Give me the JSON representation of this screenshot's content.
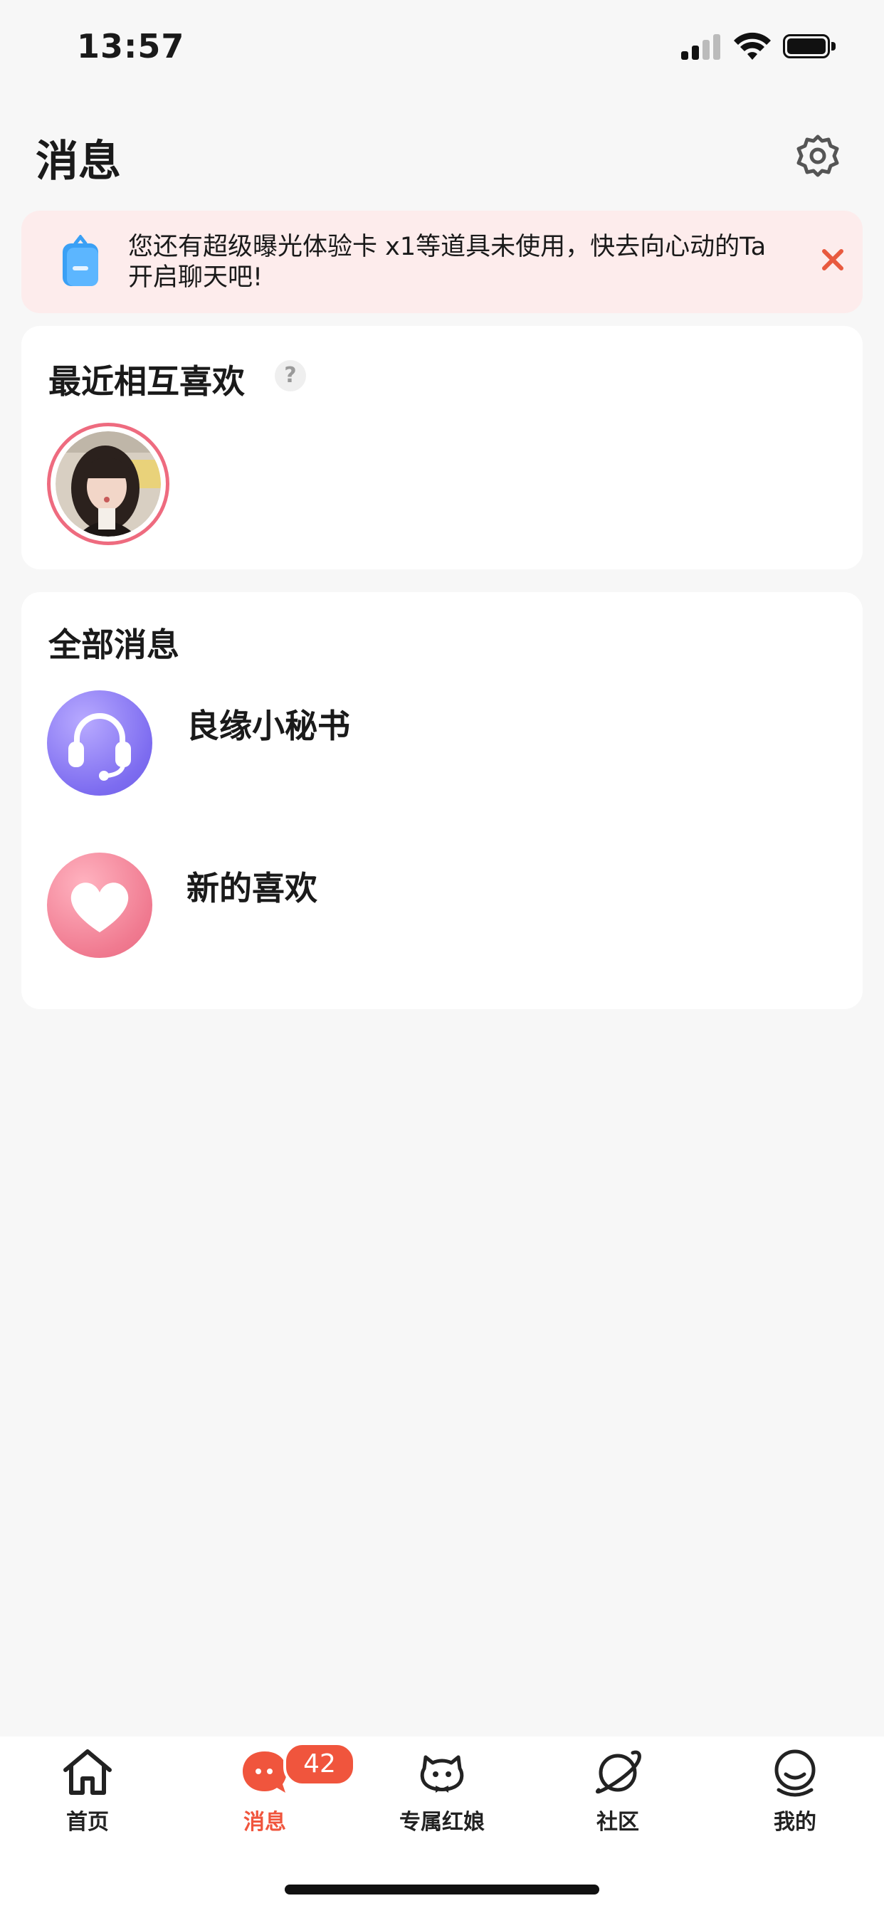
{
  "status_bar": {
    "time": "13:57"
  },
  "header": {
    "title": "消息"
  },
  "notice": {
    "text": "您还有超级曝光体验卡 x1等道具未使用，快去向心动的Ta开启聊天吧!"
  },
  "mutual_likes": {
    "title": "最近相互喜欢",
    "help": "?"
  },
  "all_messages": {
    "title": "全部消息",
    "items": [
      {
        "label": "良缘小秘书",
        "icon": "headset-icon"
      },
      {
        "label": "新的喜欢",
        "icon": "heart-icon"
      }
    ]
  },
  "tabbar": {
    "items": [
      {
        "label": "首页",
        "icon": "home-icon"
      },
      {
        "label": "消息",
        "icon": "chat-bubble-icon"
      },
      {
        "label": "专属红娘",
        "icon": "matchmaker-icon"
      },
      {
        "label": "社区",
        "icon": "planet-icon"
      },
      {
        "label": "我的",
        "icon": "profile-icon"
      }
    ],
    "badge_count": "42"
  },
  "colors": {
    "accent": "#f0553d",
    "notice_bg": "#fdecec",
    "avatar_ring": "#ee6b7f"
  }
}
